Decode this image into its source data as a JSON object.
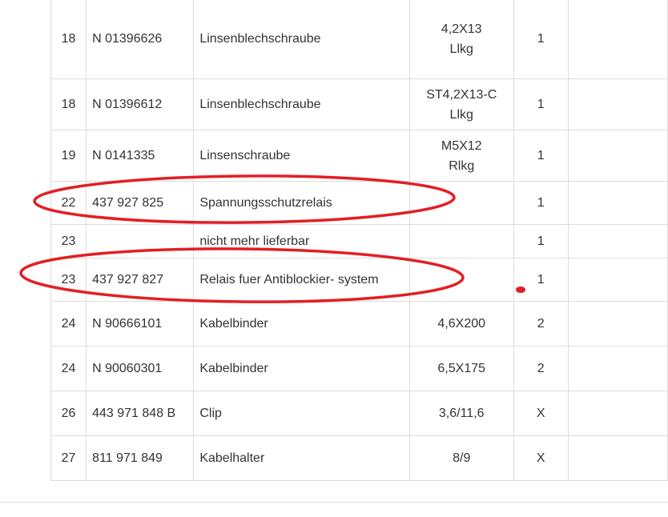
{
  "table": {
    "rows": [
      {
        "pos": "18",
        "part_no": "N  01396626",
        "description": "Linsenblechschraube",
        "spec": "4,2X13\nLlkg",
        "qty": "1"
      },
      {
        "pos": "18",
        "part_no": "N  01396612",
        "description": "Linsenblechschraube",
        "spec": "ST4,2X13-C\nLlkg",
        "qty": "1"
      },
      {
        "pos": "19",
        "part_no": "N  0141335",
        "description": "Linsenschraube",
        "spec": "M5X12\nRlkg",
        "qty": "1"
      },
      {
        "pos": "22",
        "part_no": "437 927 825",
        "description": "Spannungsschutzrelais",
        "spec": "",
        "qty": "1"
      },
      {
        "pos": "23",
        "part_no": "",
        "description": "nicht mehr lieferbar",
        "spec": "",
        "qty": "1"
      },
      {
        "pos": "23",
        "part_no": "437 927 827",
        "description": "Relais fuer Antiblockier- system",
        "spec": "",
        "qty": "1"
      },
      {
        "pos": "24",
        "part_no": "N  90666101",
        "description": "Kabelbinder",
        "spec": "4,6X200",
        "qty": "2"
      },
      {
        "pos": "24",
        "part_no": "N  90060301",
        "description": "Kabelbinder",
        "spec": "6,5X175",
        "qty": "2"
      },
      {
        "pos": "26",
        "part_no": "443 971 848 B",
        "description": "Clip",
        "spec": "3,6/11,6",
        "qty": "X"
      },
      {
        "pos": "27",
        "part_no": "811 971 849",
        "description": "Kabelhalter",
        "spec": "8/9",
        "qty": "X"
      }
    ]
  },
  "colors": {
    "annotation": "#e31e24",
    "border": "#dcdcdc",
    "text": "#333333"
  }
}
